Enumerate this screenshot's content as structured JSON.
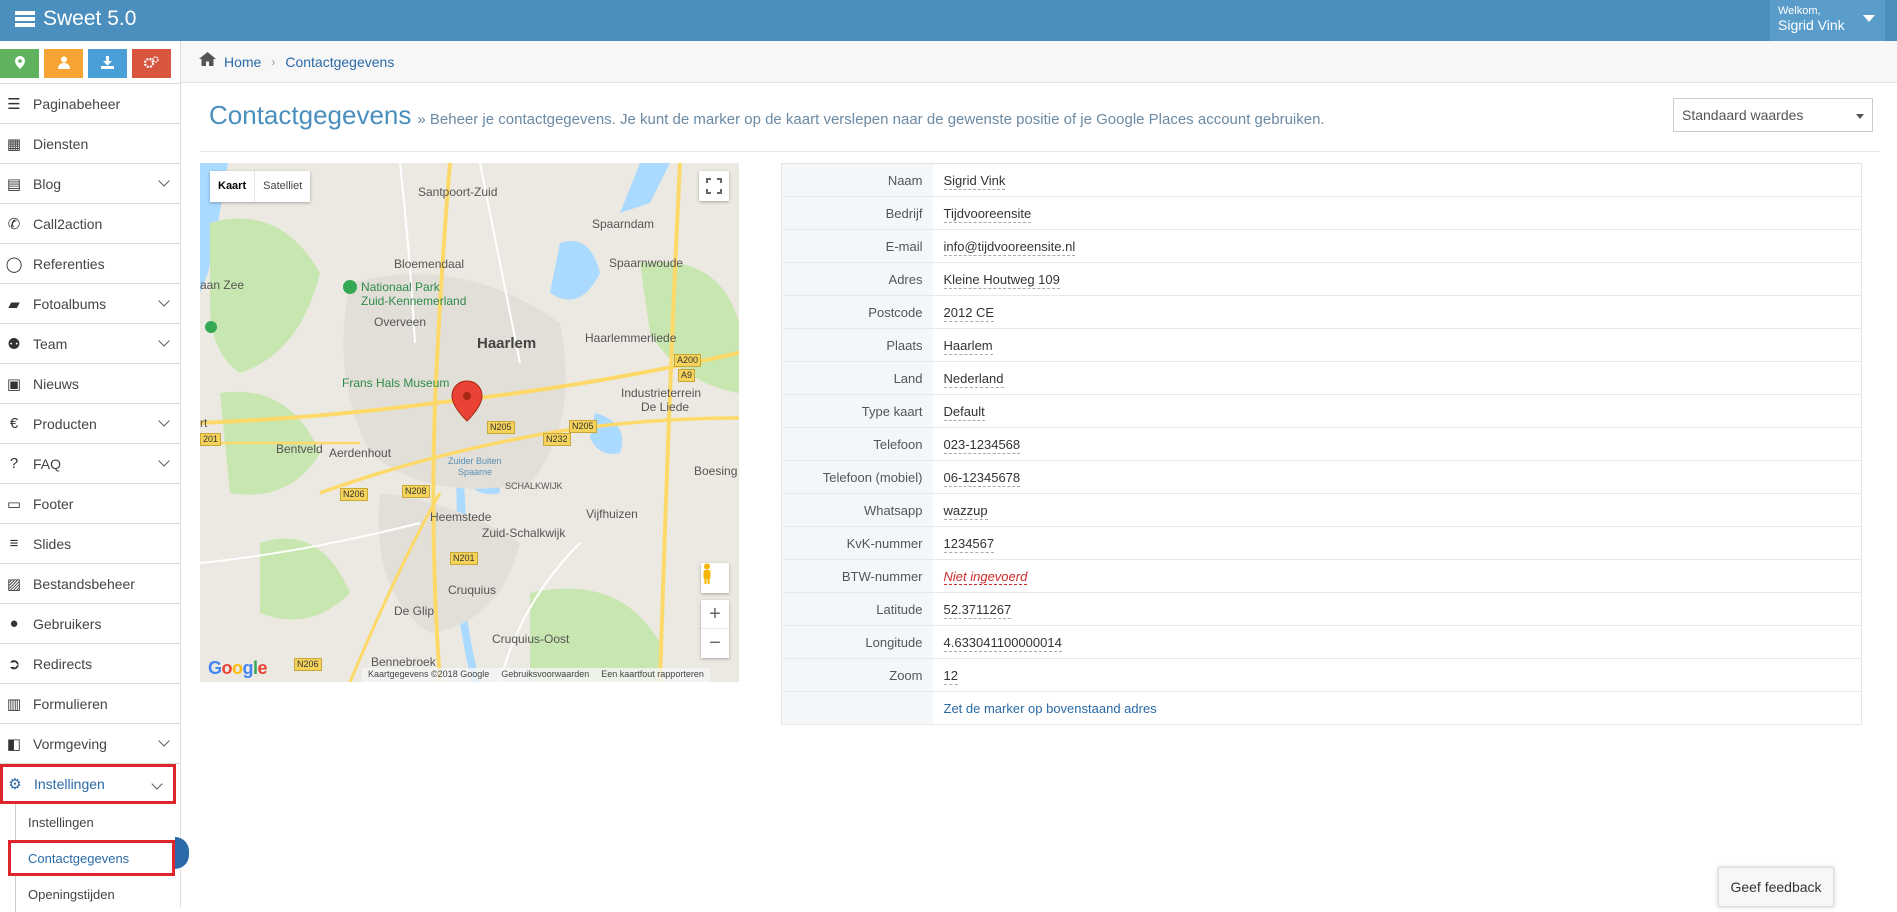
{
  "app": {
    "title": "Sweet 5.0"
  },
  "user": {
    "welcome": "Welkom,",
    "name": "Sigrid Vink"
  },
  "quick_buttons": [
    {
      "icon": "map-marker-icon",
      "color": "#5fb35f"
    },
    {
      "icon": "user-icon",
      "color": "#f6a534"
    },
    {
      "icon": "download-icon",
      "color": "#4a9fd8"
    },
    {
      "icon": "cogs-icon",
      "color": "#d8553f"
    }
  ],
  "sidebar": {
    "items": [
      {
        "label": "Paginabeheer",
        "icon": "bars-icon"
      },
      {
        "label": "Diensten",
        "icon": "cubes-icon"
      },
      {
        "label": "Blog",
        "icon": "file-icon"
      },
      {
        "label": "Call2action",
        "icon": "phone-volume-icon"
      },
      {
        "label": "Referenties",
        "icon": "comment-icon"
      },
      {
        "label": "Fotoalbums",
        "icon": "book-icon"
      },
      {
        "label": "Team",
        "icon": "users-icon"
      },
      {
        "label": "Nieuws",
        "icon": "newspaper-icon"
      },
      {
        "label": "Producten",
        "icon": "euro-icon"
      },
      {
        "label": "FAQ",
        "icon": "question-circle-icon"
      },
      {
        "label": "Footer",
        "icon": "footer-icon"
      },
      {
        "label": "Slides",
        "icon": "sliders-icon"
      },
      {
        "label": "Bestandsbeheer",
        "icon": "image-icon"
      },
      {
        "label": "Gebruikers",
        "icon": "user-icon"
      },
      {
        "label": "Redirects",
        "icon": "arrow-circle-icon"
      },
      {
        "label": "Formulieren",
        "icon": "form-icon"
      },
      {
        "label": "Vormgeving",
        "icon": "layout-icon"
      },
      {
        "label": "Instellingen",
        "icon": "gear-icon"
      }
    ],
    "sub_items": [
      {
        "label": "Instellingen"
      },
      {
        "label": "Contactgegevens"
      },
      {
        "label": "Openingstijden"
      }
    ]
  },
  "breadcrumb": {
    "home": "Home",
    "current": "Contactgegevens"
  },
  "page": {
    "title": "Contactgegevens",
    "description": "» Beheer je contactgegevens. Je kunt de marker op de kaart verslepen naar de gewenste positie of je Google Places account gebruiken.",
    "select_value": "Standaard waardes"
  },
  "map": {
    "type_map": "Kaart",
    "type_satellite": "Satelliet",
    "logo": "Google",
    "footer": [
      "Kaartgegevens ©2018 Google",
      "Gebruiksvoorwaarden",
      "Een kaartfout rapporteren"
    ],
    "labels": {
      "santpoort": "Santpoort-Zuid",
      "spaarndam": "Spaarndam",
      "bloemendaal": "Bloemendaal",
      "spaarnwoude": "Spaarnwoude",
      "aanzee": "aan Zee",
      "np1": "Nationaal Park",
      "np2": "Zuid-Kennemerland",
      "overveen": "Overveen",
      "haarlemmerliede": "Haarlemmerliede",
      "haarlem": "Haarlem",
      "franshals": "Frans Hals Museum",
      "industrie1": "Industrieterrein",
      "industrie2": "De Liede",
      "bentveld": "Bentveld",
      "aerdenhout": "Aerdenhout",
      "zuiderbuiten1": "Zuider Buiten",
      "zuiderbuiten2": "Spaarne",
      "boesing": "Boesing",
      "schalkwijk": "SCHALKWIJK",
      "heemstede": "Heemstede",
      "vijfhuizen": "Vijfhuizen",
      "zuidschalkwijk": "Zuid-Schalkwijk",
      "cruquius": "Cruquius",
      "deglip": "De Glip",
      "cruquiusoost": "Cruquius-Oost",
      "bennebroek": "Bennebroek",
      "rt": "rt"
    },
    "roads": [
      "A200",
      "A9",
      "N205",
      "N205",
      "N232",
      "N208",
      "N206",
      "N201",
      "N206",
      "201"
    ]
  },
  "contact": {
    "rows": [
      {
        "label": "Naam",
        "value": "Sigrid Vink"
      },
      {
        "label": "Bedrijf",
        "value": "Tijdvooreensite"
      },
      {
        "label": "E-mail",
        "value": "info@tijdvooreensite.nl"
      },
      {
        "label": "Adres",
        "value": "Kleine Houtweg 109"
      },
      {
        "label": "Postcode",
        "value": "2012 CE"
      },
      {
        "label": "Plaats",
        "value": "Haarlem"
      },
      {
        "label": "Land",
        "value": "Nederland"
      },
      {
        "label": "Type kaart",
        "value": "Default"
      },
      {
        "label": "Telefoon",
        "value": "023-1234568"
      },
      {
        "label": "Telefoon (mobiel)",
        "value": "06-12345678"
      },
      {
        "label": "Whatsapp",
        "value": "wazzup"
      },
      {
        "label": "KvK-nummer",
        "value": "1234567"
      },
      {
        "label": "BTW-nummer",
        "value": "Niet ingevoerd"
      },
      {
        "label": "Latitude",
        "value": "52.3711267"
      },
      {
        "label": "Longitude",
        "value": "4.633041100000014"
      },
      {
        "label": "Zoom",
        "value": "12"
      }
    ],
    "set_marker_link": "Zet de marker op bovenstaand adres"
  },
  "feedback": {
    "label": "Geef feedback"
  },
  "colors": {
    "topbar": "#4a8fbe",
    "accent": "#2a6aa8",
    "highlight": "#e0242b",
    "missing": "#d12a2a"
  }
}
